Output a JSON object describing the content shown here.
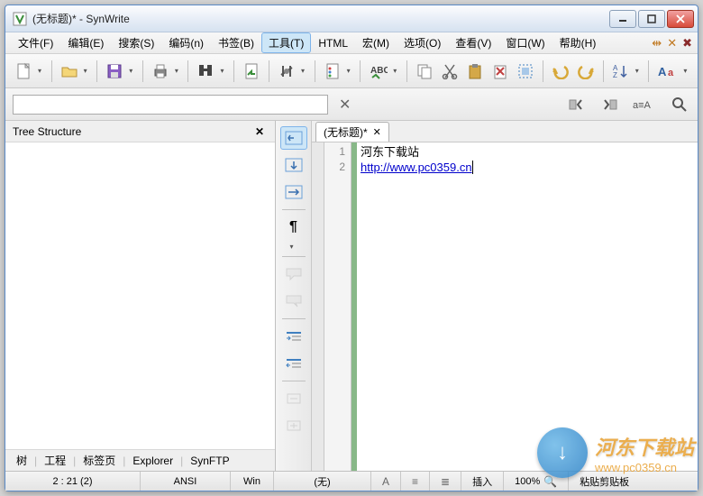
{
  "window": {
    "title": "(无标题)* - SynWrite"
  },
  "menu": {
    "items": [
      "文件(F)",
      "编辑(E)",
      "搜索(S)",
      "编码(n)",
      "书签(B)",
      "工具(T)",
      "HTML",
      "宏(M)",
      "选项(O)",
      "查看(V)",
      "窗口(W)",
      "帮助(H)"
    ],
    "active_index": 5
  },
  "sidepanel": {
    "title": "Tree Structure",
    "tabs": [
      "树",
      "工程",
      "标签页",
      "Explorer",
      "SynFTP"
    ]
  },
  "doc_tab": {
    "label": "(无标题)*"
  },
  "editor": {
    "lines": [
      {
        "num": "1",
        "text": "河东下载站"
      },
      {
        "num": "2",
        "url": "http://www.pc0359.cn"
      }
    ]
  },
  "status": {
    "pos": "2 : 21 (2)",
    "encoding": "ANSI",
    "lineend": "Win",
    "lexer": "(无)",
    "mode": "插入",
    "zoom": "100%",
    "clip": "粘贴剪贴板"
  },
  "watermark": {
    "text": "河东下载站",
    "url": "www.pc0359.cn"
  }
}
